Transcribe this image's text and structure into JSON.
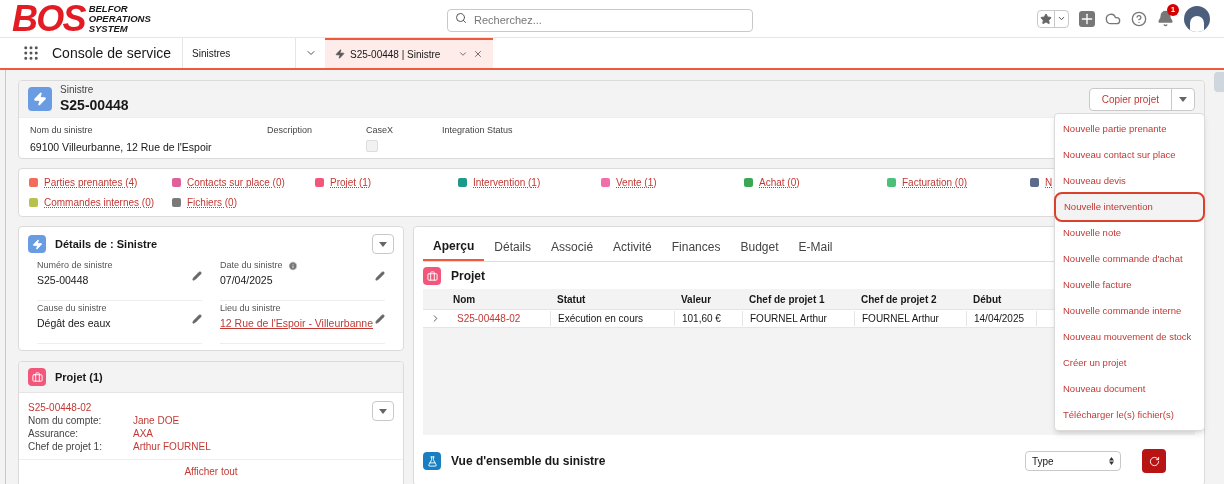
{
  "header": {
    "logo_mark": "BOS",
    "logo_text": [
      "BELFOR",
      "OPERATIONS",
      "SYSTEM"
    ],
    "search": {
      "placeholder": "Recherchez..."
    },
    "notification_count": "1"
  },
  "nav": {
    "app_name": "Console de service",
    "tabs": [
      {
        "label": "Sinistres",
        "kind": "object",
        "selected": false
      },
      {
        "label": "S25-00448 | Sinistre",
        "kind": "record",
        "selected": true
      }
    ]
  },
  "record": {
    "object": "Sinistre",
    "name": "S25-00448",
    "action": "Copier projet",
    "fields": [
      {
        "label": "Nom du sinistre",
        "value": "69100 Villeurbanne, 12 Rue de l'Espoir",
        "kind": "text"
      },
      {
        "label": "Description",
        "kind": "text"
      },
      {
        "label": "CaseX",
        "kind": "checkbox",
        "checked": false
      },
      {
        "label": "Integration Status",
        "kind": "text"
      }
    ]
  },
  "related_links": [
    {
      "label": "Parties prenantes (4)",
      "color": "#f26b5b"
    },
    {
      "label": "Contacts sur place (0)",
      "color": "#e0609a"
    },
    {
      "label": "Projet (1)",
      "color": "#f2577b"
    },
    {
      "label": "Intervention (1)",
      "color": "#1b9a8a"
    },
    {
      "label": "Vente (1)",
      "color": "#f06ea9"
    },
    {
      "label": "Achat (0)",
      "color": "#3ba755"
    },
    {
      "label": "Facturation (0)",
      "color": "#4bc076"
    },
    {
      "label": "N",
      "color": "#5a6b8c"
    },
    {
      "label": "Commandes internes (0)",
      "color": "#b7c24a"
    },
    {
      "label": "Fichiers (0)",
      "color": "#7a7a7a"
    }
  ],
  "action_menu": [
    {
      "label": "Nouvelle partie prenante",
      "selected": false
    },
    {
      "label": "Nouveau contact sur place",
      "selected": false
    },
    {
      "label": "Nouveau devis",
      "selected": false
    },
    {
      "label": "Nouvelle intervention",
      "selected": true
    },
    {
      "label": "Nouvelle note",
      "selected": false
    },
    {
      "label": "Nouvelle commande d'achat",
      "selected": false
    },
    {
      "label": "Nouvelle facture",
      "selected": false
    },
    {
      "label": "Nouvelle commande interne",
      "selected": false
    },
    {
      "label": "Nouveau mouvement de stock",
      "selected": false
    },
    {
      "label": "Créer un projet",
      "selected": false
    },
    {
      "label": "Nouveau document",
      "selected": false
    },
    {
      "label": "Télécharger le(s) fichier(s)",
      "selected": false
    }
  ],
  "details": {
    "title": "Détails de : Sinistre",
    "fields": [
      {
        "label": "Numéro de sinistre",
        "value": "S25-00448",
        "kind": "text",
        "info": false
      },
      {
        "label": "Date du sinistre",
        "value": "07/04/2025",
        "kind": "text",
        "info": true
      },
      {
        "label": "Cause du sinistre",
        "value": "Dégât des eaux",
        "kind": "text",
        "info": false
      },
      {
        "label": "Lieu du sinistre",
        "value": "12 Rue de l'Espoir - Villeurbanne",
        "kind": "link",
        "info": false
      }
    ]
  },
  "project_card": {
    "title": "Projet (1)",
    "record": "S25-00448-02",
    "fields": [
      {
        "label": "Nom du compte:",
        "value": "Jane DOE"
      },
      {
        "label": "Assurance:",
        "value": "AXA"
      },
      {
        "label": "Chef de projet 1:",
        "value": "Arthur FOURNEL"
      }
    ],
    "footer": "Afficher tout"
  },
  "main_tabs": [
    {
      "label": "Aperçu",
      "selected": true
    },
    {
      "label": "Détails",
      "selected": false
    },
    {
      "label": "Associé",
      "selected": false
    },
    {
      "label": "Activité",
      "selected": false
    },
    {
      "label": "Finances",
      "selected": false
    },
    {
      "label": "Budget",
      "selected": false
    },
    {
      "label": "E-Mail",
      "selected": false
    }
  ],
  "project_table": {
    "title": "Projet",
    "columns": [
      "Nom",
      "Statut",
      "Valeur",
      "Chef de projet 1",
      "Chef de projet 2",
      "Début"
    ],
    "rows": [
      [
        "S25-00448-02",
        "Exécution en cours",
        "101,60 €",
        "FOURNEL Arthur",
        "FOURNEL Arthur",
        "14/04/2025"
      ]
    ]
  },
  "overview": {
    "title": "Vue d'ensemble du sinistre",
    "select": "Type"
  }
}
